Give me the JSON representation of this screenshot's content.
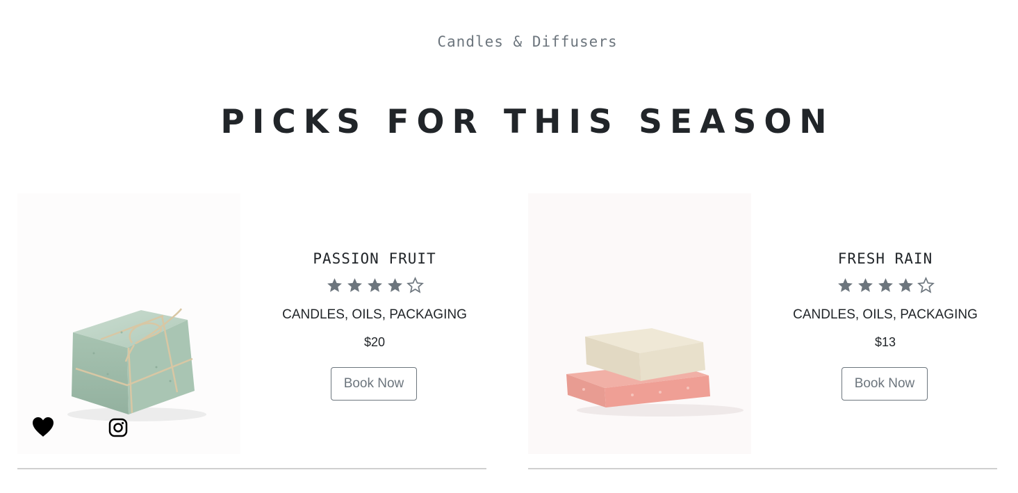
{
  "section": {
    "subtitle": "Candles & Diffusers",
    "title": "PICKS FOR THIS SEASON"
  },
  "products": [
    {
      "name": "PASSION FRUIT",
      "rating": 4,
      "rating_max": 5,
      "tags": "CANDLES, OILS, PACKAGING",
      "price": "$20",
      "button_label": "Book Now",
      "image": "green soap bar tied with twine",
      "icons": [
        "heart-icon",
        "instagram-icon"
      ]
    },
    {
      "name": "FRESH RAIN",
      "rating": 4,
      "rating_max": 5,
      "tags": "CANDLES, OILS, PACKAGING",
      "price": "$13",
      "button_label": "Book Now",
      "image": "stacked cream and pink soap bars"
    }
  ],
  "colors": {
    "star": "#6c757d",
    "button_border": "#6c757d",
    "text": "#212529",
    "divider": "#cfcfcf"
  }
}
